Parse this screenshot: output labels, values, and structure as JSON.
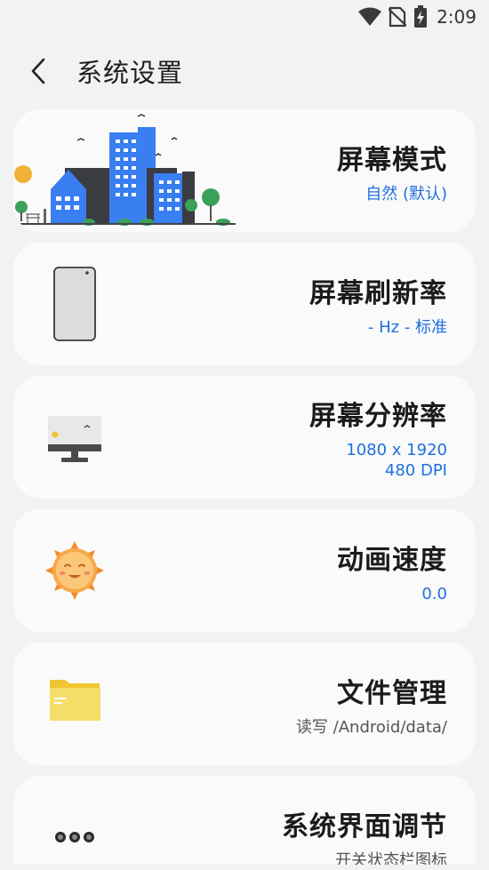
{
  "status": {
    "time": "2:09"
  },
  "header": {
    "title": "系统设置"
  },
  "items": [
    {
      "title": "屏幕模式",
      "subtitle": "自然 (默认)",
      "icon": "city-illustration-icon"
    },
    {
      "title": "屏幕刷新率",
      "subtitle": "- Hz - 标准",
      "icon": "phone-icon"
    },
    {
      "title": "屏幕分辨率",
      "subtitle_lines": [
        "1080 x 1920",
        "480 DPI"
      ],
      "icon": "monitor-icon"
    },
    {
      "title": "动画速度",
      "subtitle": "0.0",
      "icon": "sun-face-icon"
    },
    {
      "title": "文件管理",
      "subtitle": "读写 /Android/data/",
      "icon": "folder-icon"
    },
    {
      "title": "系统界面调节",
      "subtitle": "开关状态栏图标",
      "icon": "more-dots-icon"
    }
  ],
  "colors": {
    "accent": "#1e6fe0",
    "card": "#fafafa",
    "background": "#f2f2f2"
  }
}
